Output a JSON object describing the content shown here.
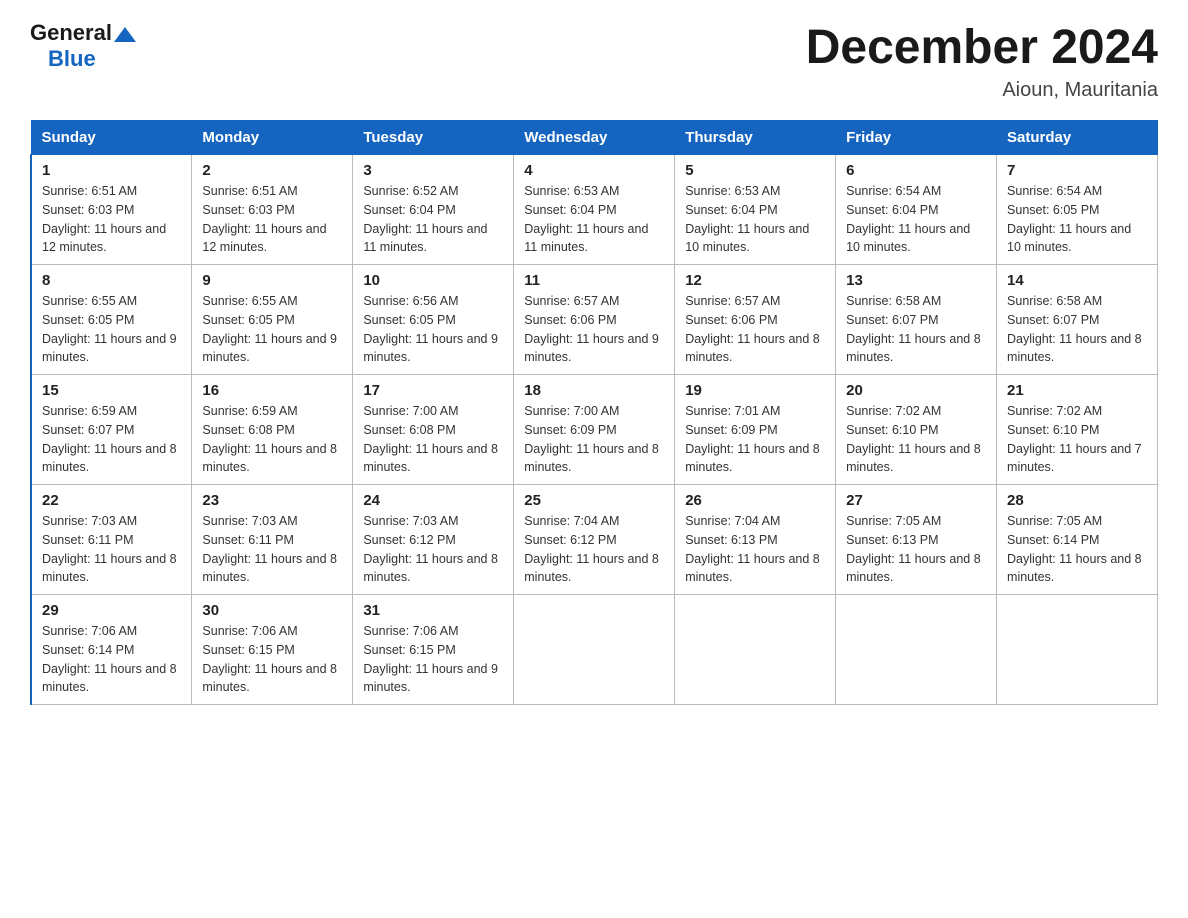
{
  "header": {
    "logo_general": "General",
    "logo_blue": "Blue",
    "month_title": "December 2024",
    "location": "Aioun, Mauritania"
  },
  "days_of_week": [
    "Sunday",
    "Monday",
    "Tuesday",
    "Wednesday",
    "Thursday",
    "Friday",
    "Saturday"
  ],
  "weeks": [
    [
      {
        "num": "1",
        "sunrise": "6:51 AM",
        "sunset": "6:03 PM",
        "daylight": "11 hours and 12 minutes."
      },
      {
        "num": "2",
        "sunrise": "6:51 AM",
        "sunset": "6:03 PM",
        "daylight": "11 hours and 12 minutes."
      },
      {
        "num": "3",
        "sunrise": "6:52 AM",
        "sunset": "6:04 PM",
        "daylight": "11 hours and 11 minutes."
      },
      {
        "num": "4",
        "sunrise": "6:53 AM",
        "sunset": "6:04 PM",
        "daylight": "11 hours and 11 minutes."
      },
      {
        "num": "5",
        "sunrise": "6:53 AM",
        "sunset": "6:04 PM",
        "daylight": "11 hours and 10 minutes."
      },
      {
        "num": "6",
        "sunrise": "6:54 AM",
        "sunset": "6:04 PM",
        "daylight": "11 hours and 10 minutes."
      },
      {
        "num": "7",
        "sunrise": "6:54 AM",
        "sunset": "6:05 PM",
        "daylight": "11 hours and 10 minutes."
      }
    ],
    [
      {
        "num": "8",
        "sunrise": "6:55 AM",
        "sunset": "6:05 PM",
        "daylight": "11 hours and 9 minutes."
      },
      {
        "num": "9",
        "sunrise": "6:55 AM",
        "sunset": "6:05 PM",
        "daylight": "11 hours and 9 minutes."
      },
      {
        "num": "10",
        "sunrise": "6:56 AM",
        "sunset": "6:05 PM",
        "daylight": "11 hours and 9 minutes."
      },
      {
        "num": "11",
        "sunrise": "6:57 AM",
        "sunset": "6:06 PM",
        "daylight": "11 hours and 9 minutes."
      },
      {
        "num": "12",
        "sunrise": "6:57 AM",
        "sunset": "6:06 PM",
        "daylight": "11 hours and 8 minutes."
      },
      {
        "num": "13",
        "sunrise": "6:58 AM",
        "sunset": "6:07 PM",
        "daylight": "11 hours and 8 minutes."
      },
      {
        "num": "14",
        "sunrise": "6:58 AM",
        "sunset": "6:07 PM",
        "daylight": "11 hours and 8 minutes."
      }
    ],
    [
      {
        "num": "15",
        "sunrise": "6:59 AM",
        "sunset": "6:07 PM",
        "daylight": "11 hours and 8 minutes."
      },
      {
        "num": "16",
        "sunrise": "6:59 AM",
        "sunset": "6:08 PM",
        "daylight": "11 hours and 8 minutes."
      },
      {
        "num": "17",
        "sunrise": "7:00 AM",
        "sunset": "6:08 PM",
        "daylight": "11 hours and 8 minutes."
      },
      {
        "num": "18",
        "sunrise": "7:00 AM",
        "sunset": "6:09 PM",
        "daylight": "11 hours and 8 minutes."
      },
      {
        "num": "19",
        "sunrise": "7:01 AM",
        "sunset": "6:09 PM",
        "daylight": "11 hours and 8 minutes."
      },
      {
        "num": "20",
        "sunrise": "7:02 AM",
        "sunset": "6:10 PM",
        "daylight": "11 hours and 8 minutes."
      },
      {
        "num": "21",
        "sunrise": "7:02 AM",
        "sunset": "6:10 PM",
        "daylight": "11 hours and 7 minutes."
      }
    ],
    [
      {
        "num": "22",
        "sunrise": "7:03 AM",
        "sunset": "6:11 PM",
        "daylight": "11 hours and 8 minutes."
      },
      {
        "num": "23",
        "sunrise": "7:03 AM",
        "sunset": "6:11 PM",
        "daylight": "11 hours and 8 minutes."
      },
      {
        "num": "24",
        "sunrise": "7:03 AM",
        "sunset": "6:12 PM",
        "daylight": "11 hours and 8 minutes."
      },
      {
        "num": "25",
        "sunrise": "7:04 AM",
        "sunset": "6:12 PM",
        "daylight": "11 hours and 8 minutes."
      },
      {
        "num": "26",
        "sunrise": "7:04 AM",
        "sunset": "6:13 PM",
        "daylight": "11 hours and 8 minutes."
      },
      {
        "num": "27",
        "sunrise": "7:05 AM",
        "sunset": "6:13 PM",
        "daylight": "11 hours and 8 minutes."
      },
      {
        "num": "28",
        "sunrise": "7:05 AM",
        "sunset": "6:14 PM",
        "daylight": "11 hours and 8 minutes."
      }
    ],
    [
      {
        "num": "29",
        "sunrise": "7:06 AM",
        "sunset": "6:14 PM",
        "daylight": "11 hours and 8 minutes."
      },
      {
        "num": "30",
        "sunrise": "7:06 AM",
        "sunset": "6:15 PM",
        "daylight": "11 hours and 8 minutes."
      },
      {
        "num": "31",
        "sunrise": "7:06 AM",
        "sunset": "6:15 PM",
        "daylight": "11 hours and 9 minutes."
      },
      null,
      null,
      null,
      null
    ]
  ]
}
